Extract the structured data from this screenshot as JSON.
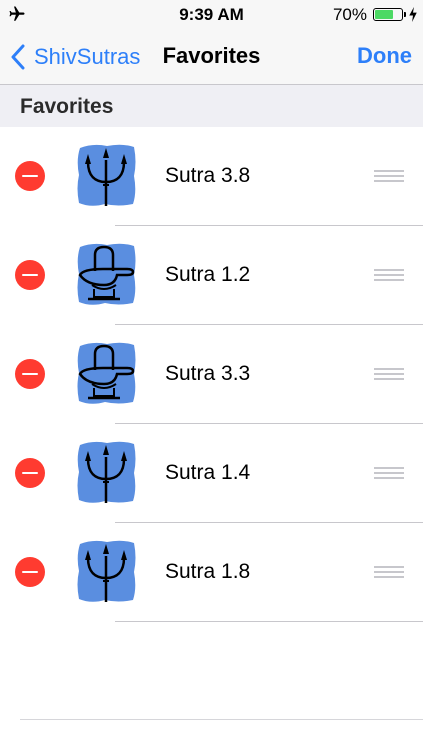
{
  "status_bar": {
    "time": "9:39 AM",
    "battery_percent": "70%",
    "battery_level": 0.7,
    "icons": [
      "airplane-icon",
      "battery-icon",
      "charging-bolt-icon"
    ]
  },
  "nav": {
    "back_label": "ShivSutras",
    "title": "Favorites",
    "done_label": "Done",
    "accent_color": "#2d7ff9"
  },
  "section": {
    "header": "Favorites"
  },
  "favorites": [
    {
      "label": "Sutra 3.8",
      "icon": "trident-icon"
    },
    {
      "label": "Sutra 1.2",
      "icon": "shiva-lingam-icon"
    },
    {
      "label": "Sutra 3.3",
      "icon": "shiva-lingam-icon"
    },
    {
      "label": "Sutra 1.4",
      "icon": "trident-icon"
    },
    {
      "label": "Sutra 1.8",
      "icon": "trident-icon"
    }
  ],
  "colors": {
    "delete": "#ff3b30",
    "thumb_bg": "#5a8ee0",
    "section_bg": "#efeff4"
  }
}
